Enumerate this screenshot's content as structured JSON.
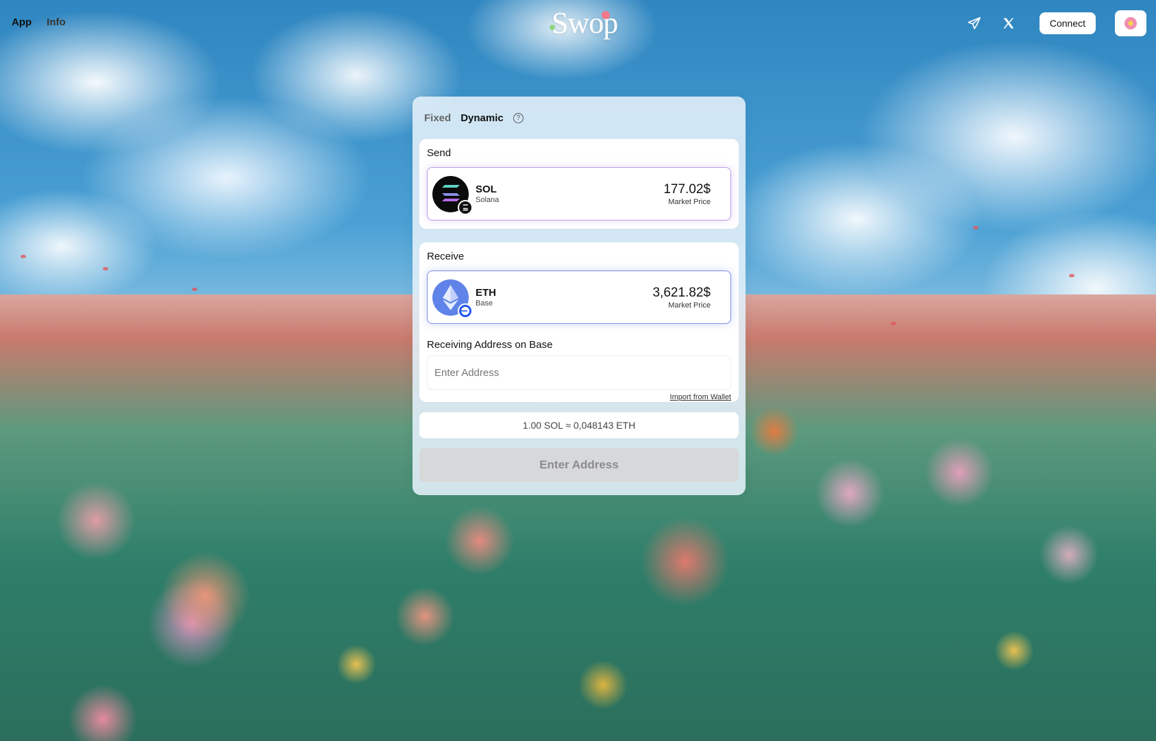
{
  "nav": {
    "app_label": "App",
    "info_label": "Info",
    "logo_text": "Swop",
    "connect_label": "Connect",
    "icons": [
      "telegram-icon",
      "x-icon",
      "flower-icon"
    ]
  },
  "swap": {
    "modes": {
      "fixed_label": "Fixed",
      "dynamic_label": "Dynamic",
      "active": "Dynamic"
    },
    "help_glyph": "?",
    "send": {
      "label": "Send",
      "ticker": "SOL",
      "chain": "Solana",
      "price": "177.02$",
      "price_caption": "Market Price"
    },
    "receive": {
      "label": "Receive",
      "ticker": "ETH",
      "chain": "Base",
      "price": "3,621.82$",
      "price_caption": "Market Price"
    },
    "address": {
      "label": "Receiving Address on Base",
      "placeholder": "Enter Address",
      "import_label": "Import from Wallet"
    },
    "rate": "1.00 SOL ≈ 0,048143 ETH",
    "submit_label": "Enter Address"
  },
  "colors": {
    "sol_border": "#b99ae8",
    "eth_border": "#7e8fe6",
    "disabled_button": "#d7d8da"
  }
}
